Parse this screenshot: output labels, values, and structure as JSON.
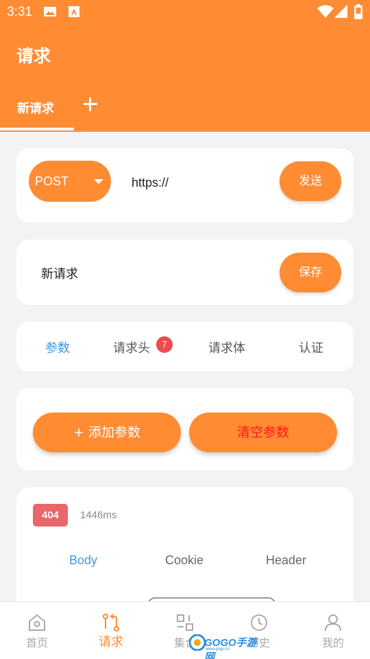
{
  "status_bar": {
    "time": "3:31"
  },
  "app_bar": {
    "title": "请求"
  },
  "request_tabs": {
    "active_label": "新请求"
  },
  "request_line": {
    "method": "POST",
    "url": "https://",
    "send_label": "发送"
  },
  "request_name": {
    "name": "新请求",
    "save_label": "保存"
  },
  "param_tabs": [
    {
      "label": "参数",
      "active": true
    },
    {
      "label": "请求头",
      "badge": "7"
    },
    {
      "label": "请求体"
    },
    {
      "label": "认证"
    }
  ],
  "params": {
    "add_label": "+ 添加参数",
    "clear_label": "清空参数"
  },
  "response": {
    "status_code": "404",
    "time": "1446ms",
    "tabs": [
      {
        "label": "Body",
        "active": true
      },
      {
        "label": "Cookie"
      },
      {
        "label": "Header"
      }
    ]
  },
  "bottom_nav": [
    {
      "label": "首页",
      "icon": "home-icon"
    },
    {
      "label": "请求",
      "icon": "request-icon",
      "active": true
    },
    {
      "label": "集合",
      "icon": "collection-icon"
    },
    {
      "label": "历史",
      "icon": "history-icon"
    },
    {
      "label": "我的",
      "icon": "profile-icon"
    }
  ],
  "watermark": {
    "brand": "GOGO手游网",
    "domain": "www.gogo.cn"
  },
  "colors": {
    "accent": "#ff8c33",
    "link_active": "#3f9ae0",
    "badge_red": "#f04a4a",
    "status_error": "#e9676b",
    "clear_text": "#ff1a1a",
    "background": "#f3f3f3"
  }
}
